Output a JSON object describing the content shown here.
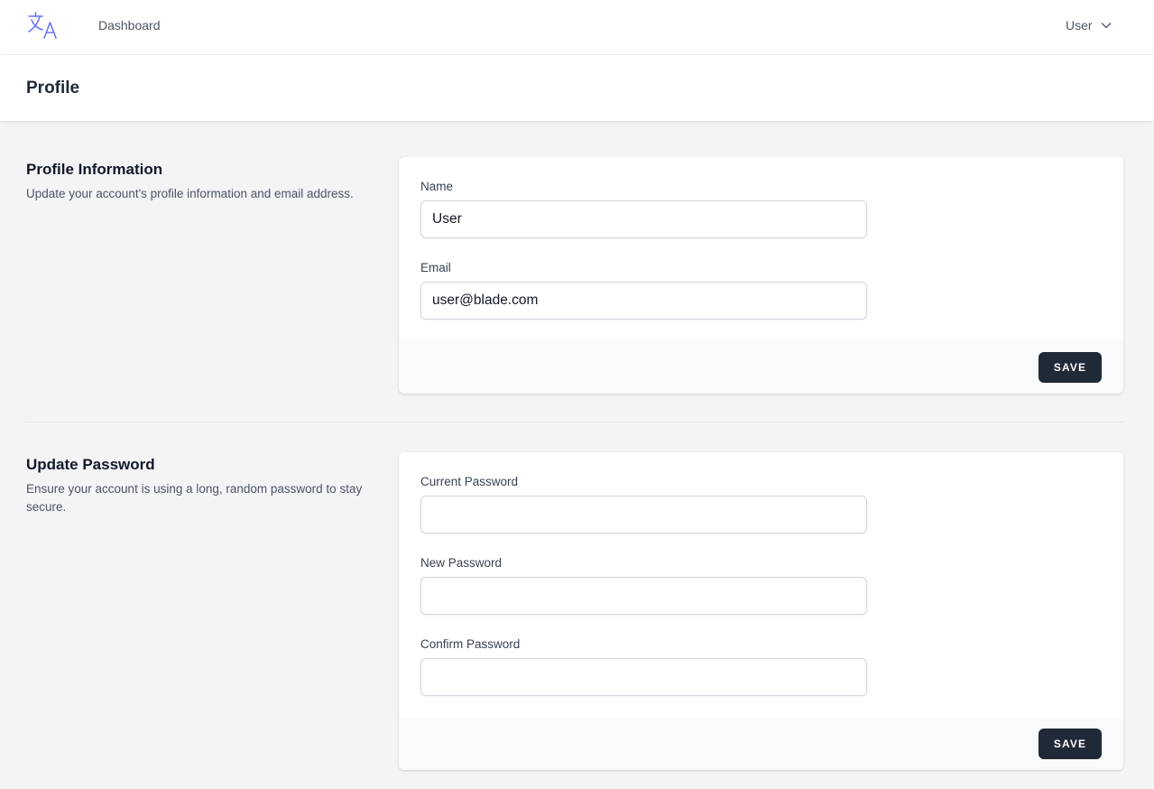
{
  "nav": {
    "logo_icon": "translate-icon",
    "dashboard_label": "Dashboard",
    "user_label": "User",
    "user_menu_icon": "chevron-down-icon"
  },
  "header": {
    "title": "Profile"
  },
  "profile_info": {
    "title": "Profile Information",
    "description": "Update your account's profile information and email address.",
    "name_label": "Name",
    "name_value": "User",
    "email_label": "Email",
    "email_value": "user@blade.com",
    "save_label": "SAVE"
  },
  "update_password": {
    "title": "Update Password",
    "description": "Ensure your account is using a long, random password to stay secure.",
    "current_label": "Current Password",
    "current_value": "",
    "new_label": "New Password",
    "new_value": "",
    "confirm_label": "Confirm Password",
    "confirm_value": "",
    "save_label": "SAVE"
  },
  "colors": {
    "accent": "#6875f5",
    "button": "#1f2937",
    "background": "#f3f4f6"
  }
}
